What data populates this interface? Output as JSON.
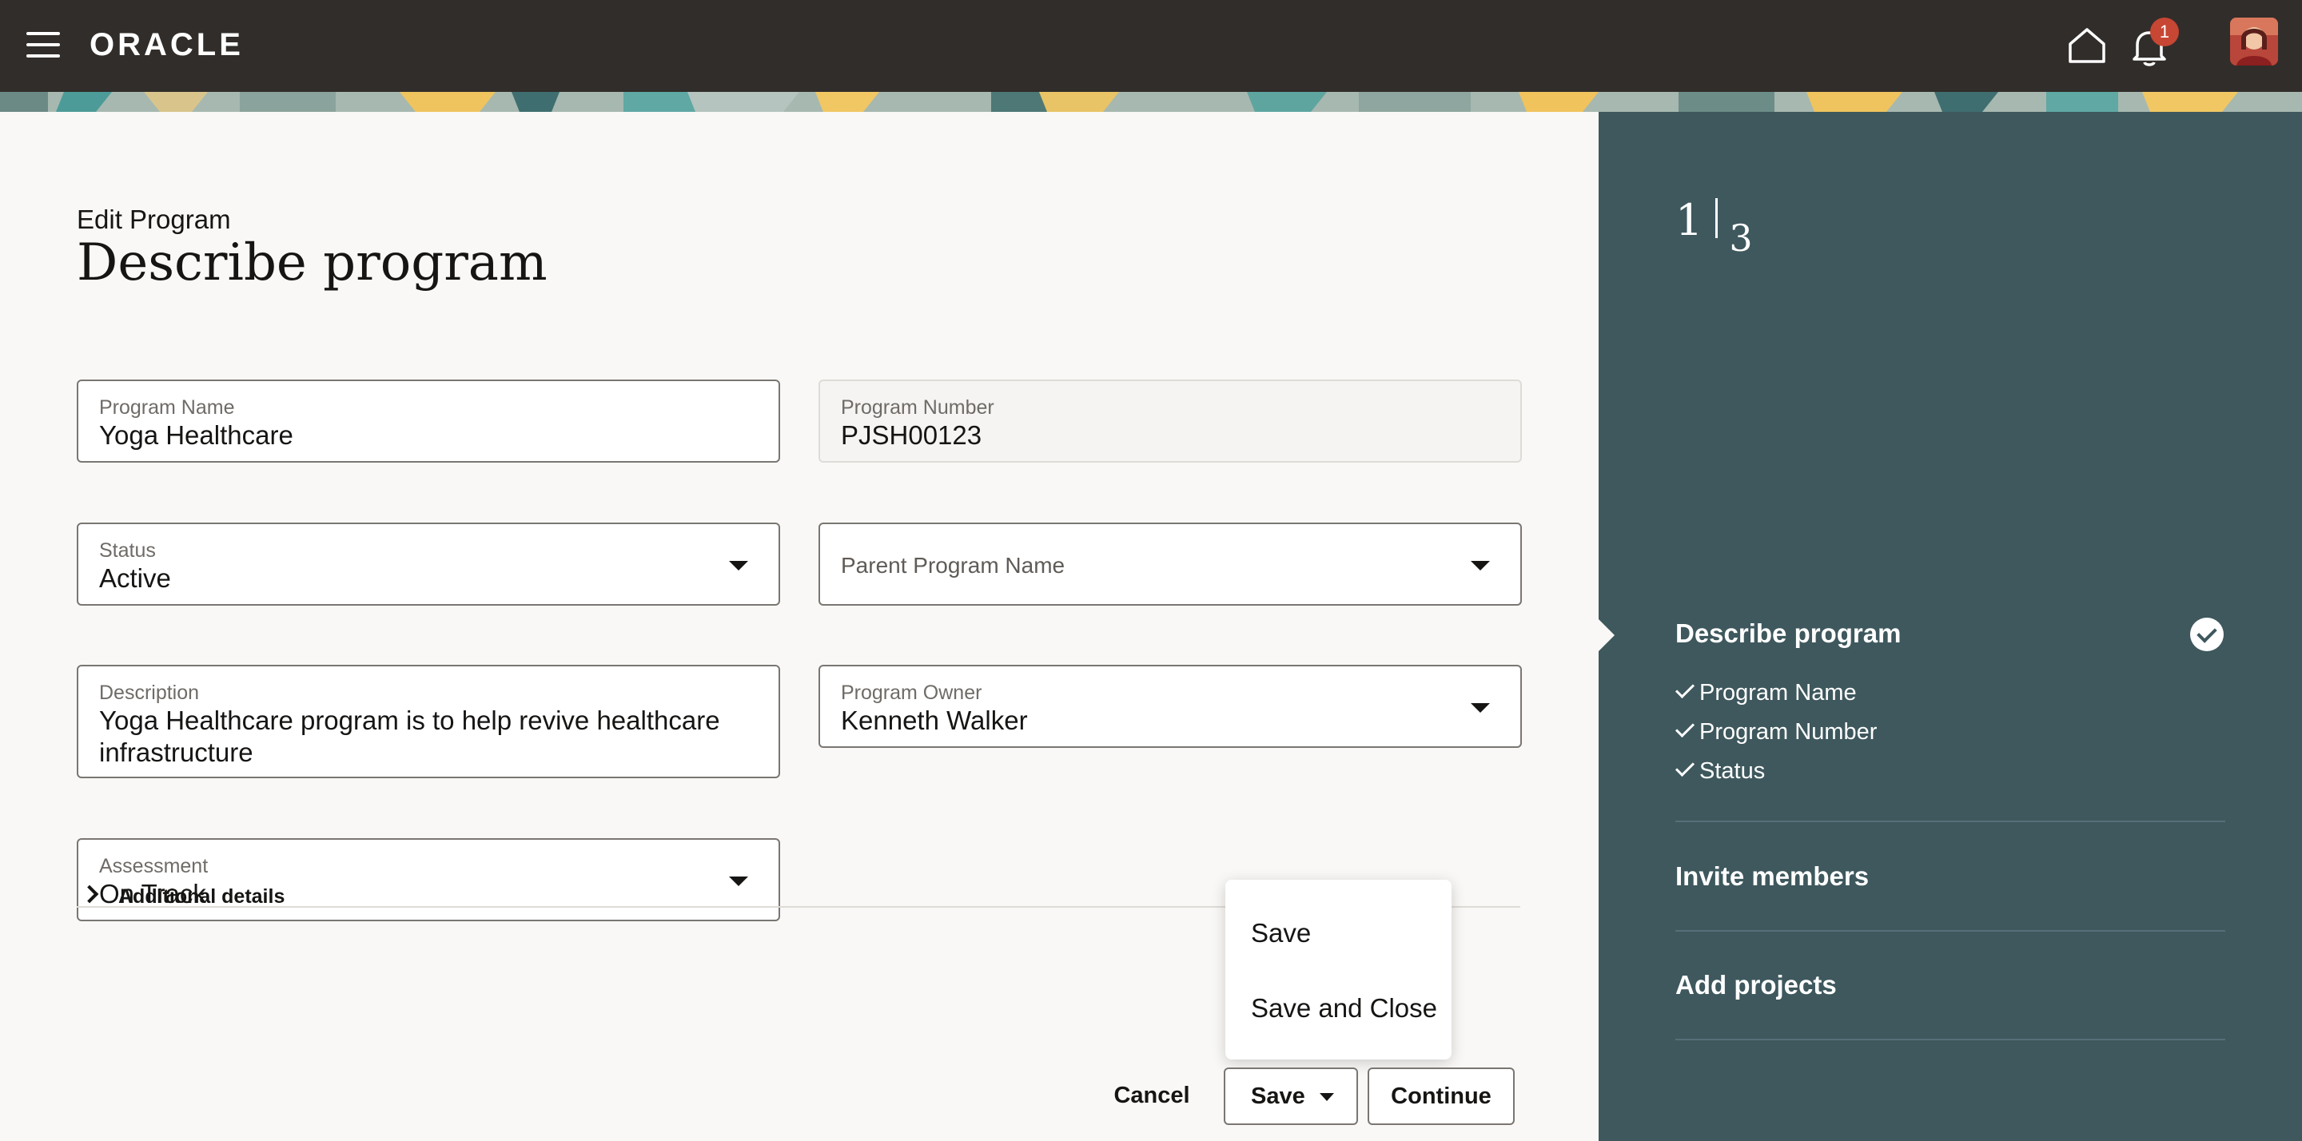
{
  "header": {
    "brand": "ORACLE",
    "notification_count": "1",
    "colors": {
      "bar": "#312d2a",
      "badge": "#c74634"
    }
  },
  "main": {
    "eyebrow": "Edit Program",
    "title": "Describe program",
    "fields": {
      "program_name": {
        "label": "Program Name",
        "value": "Yoga Healthcare"
      },
      "program_number": {
        "label": "Program Number",
        "value": "PJSH00123"
      },
      "status": {
        "label": "Status",
        "value": "Active"
      },
      "parent_program": {
        "label": "Parent Program Name",
        "value": ""
      },
      "description": {
        "label": "Description",
        "value": "Yoga Healthcare program is to help revive healthcare infrastructure"
      },
      "program_owner": {
        "label": "Program Owner",
        "value": "Kenneth Walker"
      },
      "assessment": {
        "label": "Assessment",
        "value": "On Track"
      }
    },
    "additional_details": "Additional details"
  },
  "save_menu": {
    "items": [
      "Save",
      "Save and Close"
    ]
  },
  "footer": {
    "cancel": "Cancel",
    "save": "Save",
    "continue": "Continue"
  },
  "stepper": {
    "current": "1",
    "total": "3",
    "steps": [
      {
        "title": "Describe program",
        "completed": true,
        "subitems": [
          "Program Name",
          "Program Number",
          "Status"
        ]
      },
      {
        "title": "Invite members",
        "completed": false
      },
      {
        "title": "Add projects",
        "completed": false
      }
    ],
    "colors": {
      "panel": "#3e585d"
    }
  }
}
